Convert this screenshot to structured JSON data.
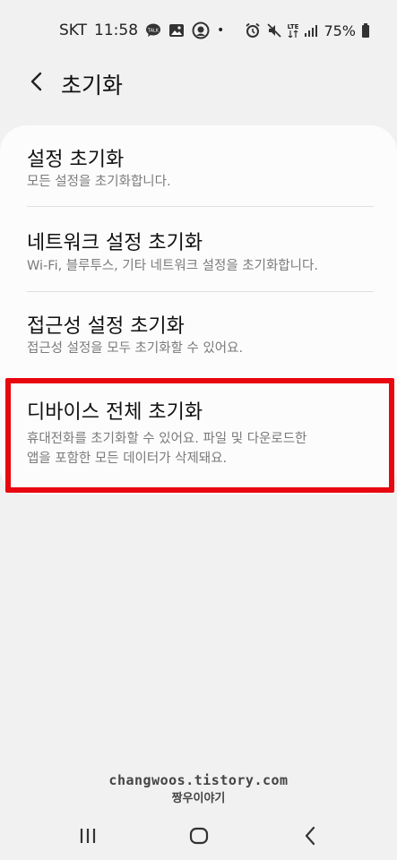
{
  "status_bar": {
    "carrier": "SKT",
    "time": "11:58",
    "notification_icons": [
      "talk-icon",
      "gallery-icon",
      "location-icon"
    ],
    "dot": "•",
    "network_label": "LTE",
    "battery_percent": "75%"
  },
  "header": {
    "back_icon": "chevron-left-icon",
    "title": "초기화"
  },
  "items": [
    {
      "title": "설정 초기화",
      "subtitle": "모든 설정을 초기화합니다."
    },
    {
      "title": "네트워크 설정 초기화",
      "subtitle": "Wi-Fi, 블루투스, 기타 네트워크 설정을 초기화합니다."
    },
    {
      "title": "접근성 설정 초기화",
      "subtitle": "접근성 설정을 모두 초기화할 수 있어요."
    },
    {
      "title": "디바이스 전체 초기화",
      "subtitle_line1": "휴대전화를 초기화할 수 있어요. 파일 및 다운로드한",
      "subtitle_line2": "앱을 포함한 모든 데이터가 삭제돼요.",
      "highlight_color": "#e8070f"
    }
  ],
  "watermark": {
    "line1": "changwoos.tistory.com",
    "line2": "짱우이야기"
  },
  "nav_bar": {
    "recents_icon": "recents-icon",
    "home_icon": "home-icon",
    "back_icon": "back-icon"
  }
}
